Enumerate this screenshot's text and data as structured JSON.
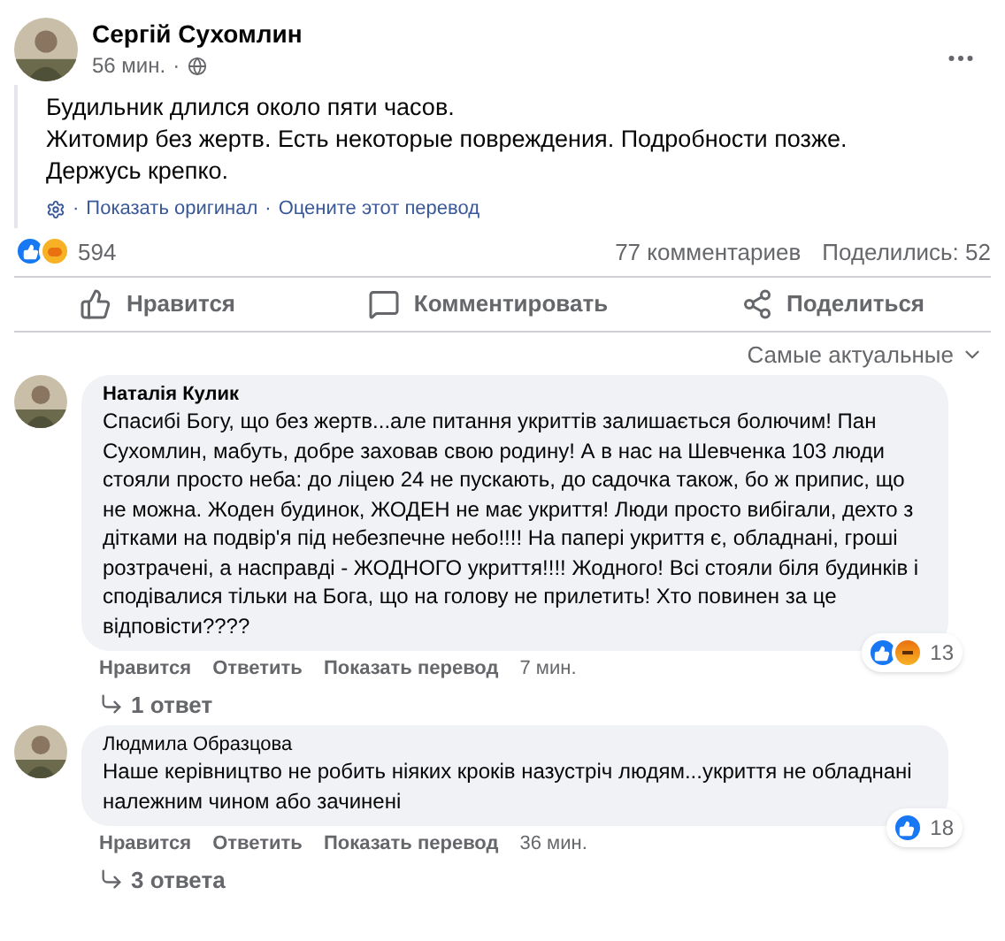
{
  "post": {
    "author": "Сергій Сухомлин",
    "time": "56 мин.",
    "separator": "·",
    "lines": [
      "Будильник длился около пяти часов.",
      "Житомир без жертв. Есть некоторые повреждения. Подробности позже.",
      "Держусь крепко."
    ],
    "translation_links": [
      "Показать оригинал",
      "Оцените этот перевод"
    ],
    "reactions": [
      {
        "kind": "like"
      },
      {
        "kind": "care"
      }
    ],
    "reaction_count": "594",
    "comments_count": "77 комментариев",
    "shares": "Поделились: 52"
  },
  "actions": [
    {
      "kind": "like",
      "label": "Нравится"
    },
    {
      "kind": "comment",
      "label": "Комментировать"
    },
    {
      "kind": "share",
      "label": "Поделиться"
    }
  ],
  "sort": "Самые актуальные",
  "comments": [
    {
      "author": "Наталія Кулик",
      "bold_name": true,
      "text": "Спасибі Богу, що без жертв...але питання укриттів залишається болючим! Пан Сухомлин, мабуть, добре заховав свою родину! А в нас на Шевченка 103 люди стояли просто неба: до ліцею 24 не пускають, до садочка також, бо ж припис, що не можна. Жоден будинок, ЖОДЕН не має укриття! Люди просто вибігали, дехто з дітками на подвір'я під небезпечне небо!!!! На папері укриття є, обладнані, гроші розтрачені, а насправді - ЖОДНОГО укриття!!!! Жодного! Всі стояли біля будинків і сподівалися тільки на Бога, що на голову не прилетить! Хто повинен за це відповісти????",
      "reactions": [
        {
          "kind": "like"
        },
        {
          "kind": "angry"
        }
      ],
      "reaction_count": "13",
      "actions": [
        "Нравится",
        "Ответить",
        "Показать перевод"
      ],
      "time": "7 мин.",
      "replies": "1 ответ"
    },
    {
      "author": "Людмила Образцова",
      "bold_name": false,
      "text": "Наше керівництво не робить ніяких кроків назустріч людям...укриття не обладнані належним чином або зачинені",
      "reactions": [
        {
          "kind": "like"
        }
      ],
      "reaction_count": "18",
      "actions": [
        "Нравится",
        "Ответить",
        "Показать перевод"
      ],
      "time": "36 мин.",
      "replies": "3 ответа"
    }
  ]
}
